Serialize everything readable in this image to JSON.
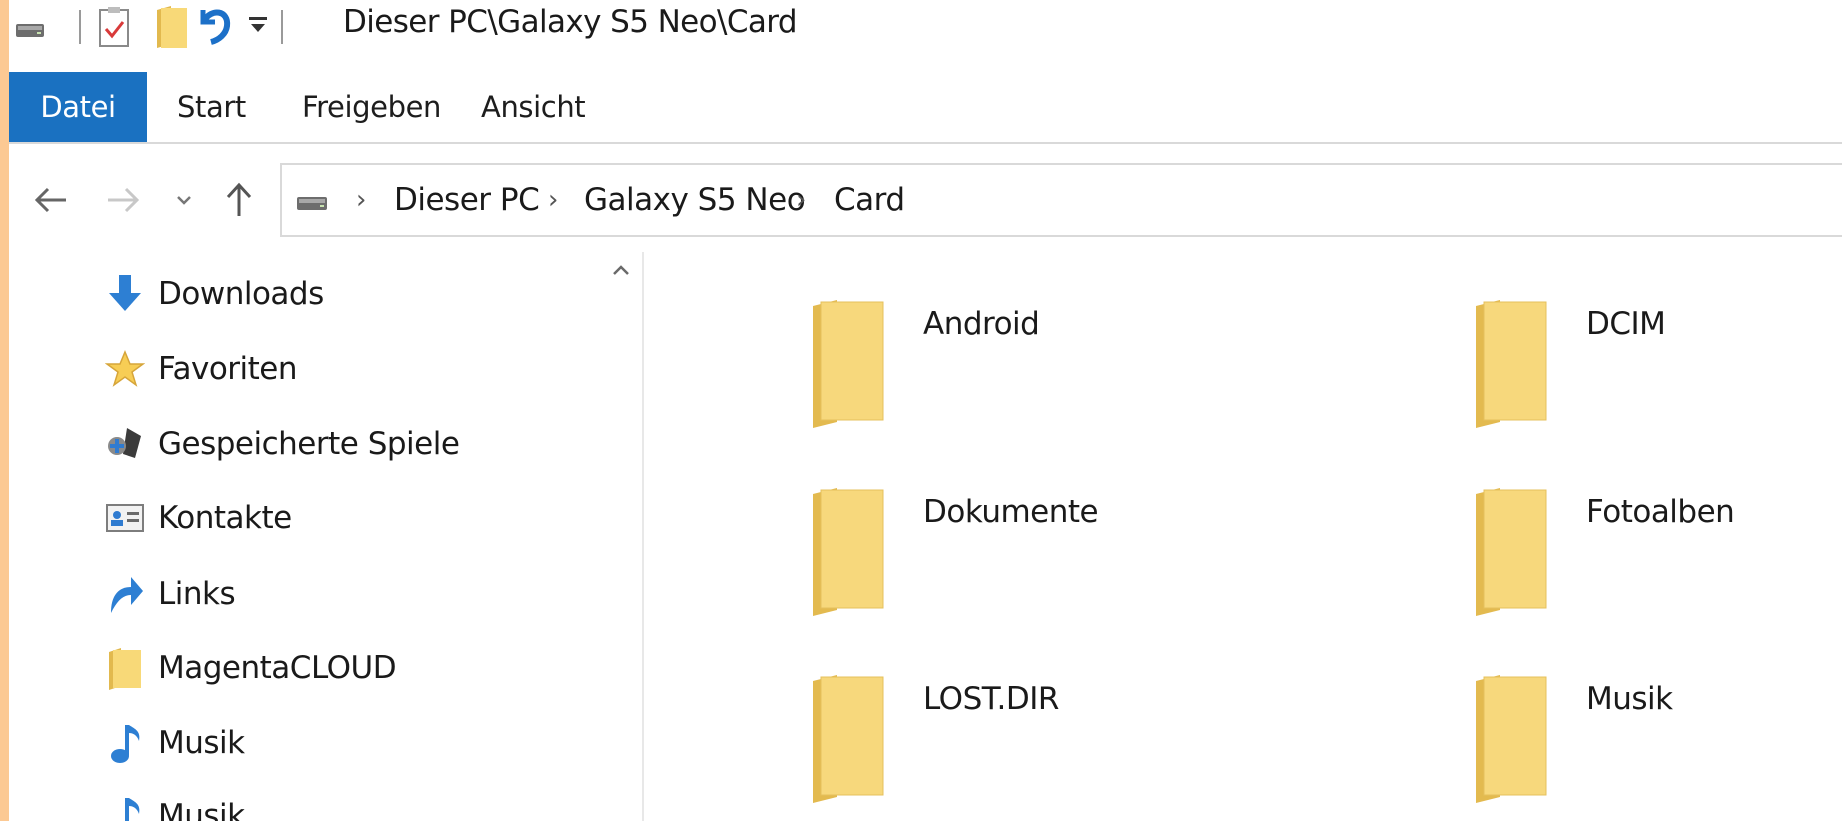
{
  "window": {
    "title": "Dieser PC\\Galaxy S5 Neo\\Card"
  },
  "ribbon": {
    "tabs": [
      {
        "label": "Datei"
      },
      {
        "label": "Start"
      },
      {
        "label": "Freigeben"
      },
      {
        "label": "Ansicht"
      }
    ]
  },
  "address": {
    "crumbs": [
      "Dieser PC",
      "Galaxy S5 Neo",
      "Card"
    ]
  },
  "nav": {
    "items": [
      {
        "label": "Downloads",
        "icon": "download-arrow-icon"
      },
      {
        "label": "Favoriten",
        "icon": "star-icon"
      },
      {
        "label": "Gespeicherte Spiele",
        "icon": "games-icon"
      },
      {
        "label": "Kontakte",
        "icon": "contact-card-icon"
      },
      {
        "label": "Links",
        "icon": "link-arrow-icon"
      },
      {
        "label": "MagentaCLOUD",
        "icon": "folder-icon"
      },
      {
        "label": "Musik",
        "icon": "music-note-icon"
      },
      {
        "label": "Musik",
        "icon": "music-note-icon"
      }
    ]
  },
  "content": {
    "folders": [
      {
        "name": "Android"
      },
      {
        "name": "DCIM"
      },
      {
        "name": "Dokumente"
      },
      {
        "name": "Fotoalben"
      },
      {
        "name": "LOST.DIR"
      },
      {
        "name": "Musik"
      }
    ]
  },
  "colors": {
    "frame": "#fcc993",
    "file_tab": "#1a71c1",
    "folder": "#f6d67a"
  }
}
